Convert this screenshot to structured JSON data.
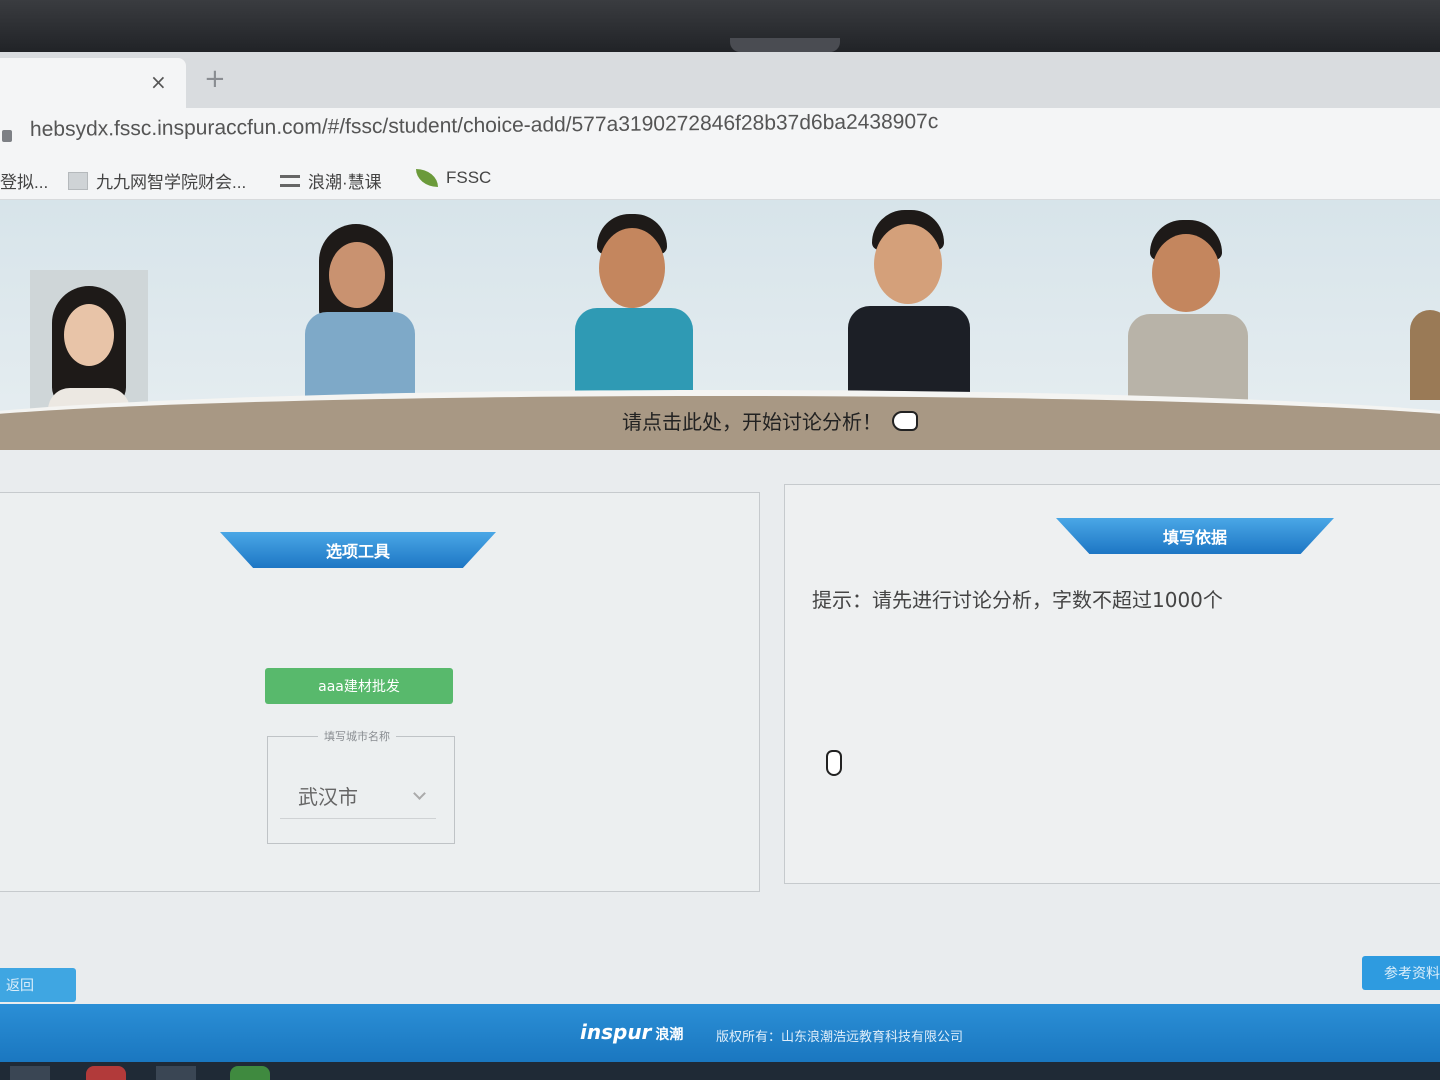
{
  "browser": {
    "tab_close": "×",
    "new_tab": "+",
    "url": "hebsydx.fssc.inspuraccfun.com/#/fssc/student/choice-add/577a3190272846f28b37d6ba2438907c",
    "bookmarks": [
      {
        "label": "登拟..."
      },
      {
        "label": "九九网智学院财会..."
      },
      {
        "label": "浪潮·慧课"
      },
      {
        "label": "FSSC"
      }
    ]
  },
  "banner": {
    "discuss_label": "请点击此处，开始讨论分析！"
  },
  "left_panel": {
    "title": "选项工具",
    "option_button": "aaa建材批发",
    "city_legend": "填写城市名称",
    "city_value": "武汉市"
  },
  "right_panel": {
    "title": "填写依据",
    "hint": "提示：请先进行讨论分析，字数不超过1000个"
  },
  "buttons": {
    "back": "返回",
    "reference": "参考资料"
  },
  "footer": {
    "logo": "inspur",
    "logo_cn": "浪潮",
    "copyright": "版权所有：山东浪潮浩远教育科技有限公司"
  },
  "colors": {
    "accent_blue": "#1d76c4",
    "option_green": "#58b96c",
    "footer_blue": "#1a77c0"
  }
}
